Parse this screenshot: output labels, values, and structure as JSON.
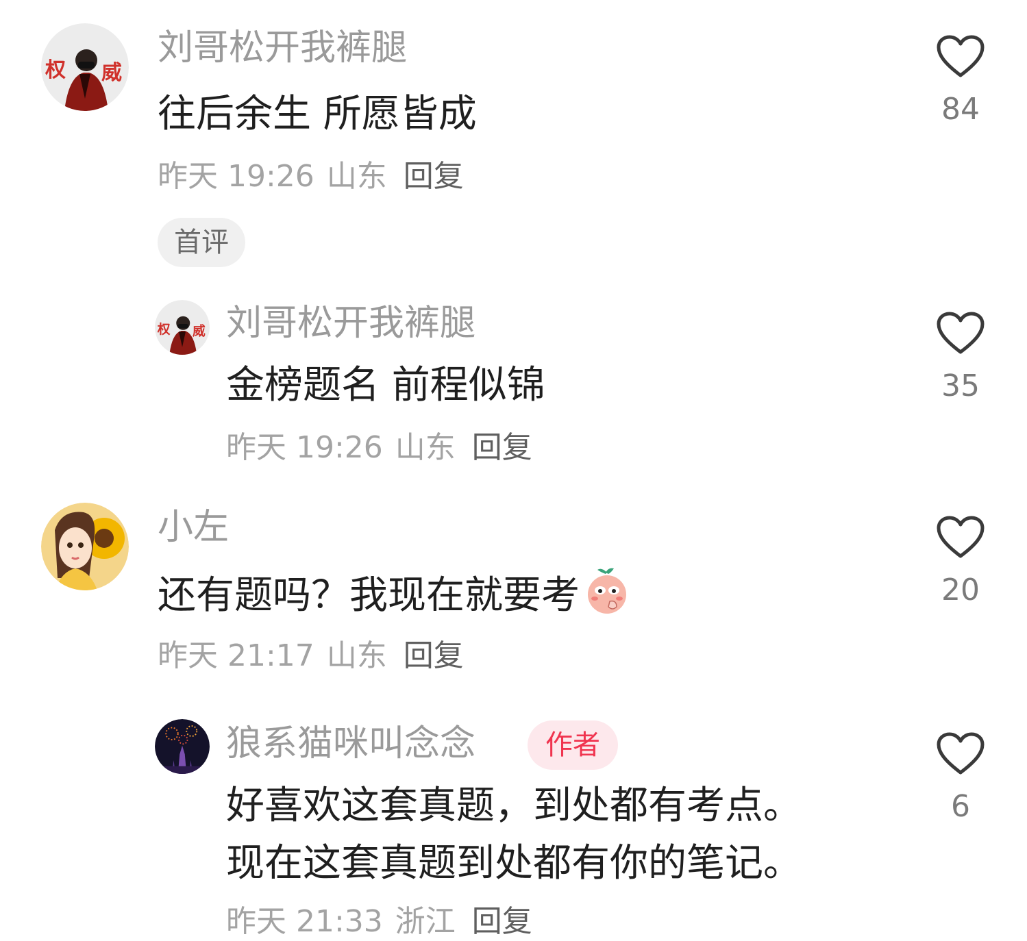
{
  "comments": [
    {
      "username": "刘哥松开我裤腿",
      "text": "往后余生 所愿皆成",
      "time": "昨天 19:26",
      "location": "山东",
      "reply_label": "回复",
      "badge": "首评",
      "likes": "84",
      "avatar_text_left": "权",
      "avatar_text_right": "威"
    },
    {
      "username": "刘哥松开我裤腿",
      "text": "金榜题名 前程似锦",
      "time": "昨天 19:26",
      "location": "山东",
      "reply_label": "回复",
      "likes": "35",
      "avatar_text_left": "权",
      "avatar_text_right": "威"
    },
    {
      "username": "小左",
      "text": "还有题吗？我现在就要考",
      "time": "昨天 21:17",
      "location": "山东",
      "reply_label": "回复",
      "likes": "20",
      "emoji": "peach-shy-emoji"
    },
    {
      "username": "狼系猫咪叫念念",
      "author_badge": "作者",
      "text_line1": "好喜欢这套真题，到处都有考点。",
      "text_line2": "现在这套真题到处都有你的笔记。",
      "time": "昨天 21:33",
      "location": "浙江",
      "reply_label": "回复",
      "likes": "6"
    }
  ],
  "icons": {
    "like": "heart-outline-icon"
  },
  "colors": {
    "username": "#9a9a9a",
    "body": "#1f1f1f",
    "meta": "#a3a3a3",
    "author_badge_bg": "#fde8ec",
    "author_badge_text": "#f0344f"
  }
}
